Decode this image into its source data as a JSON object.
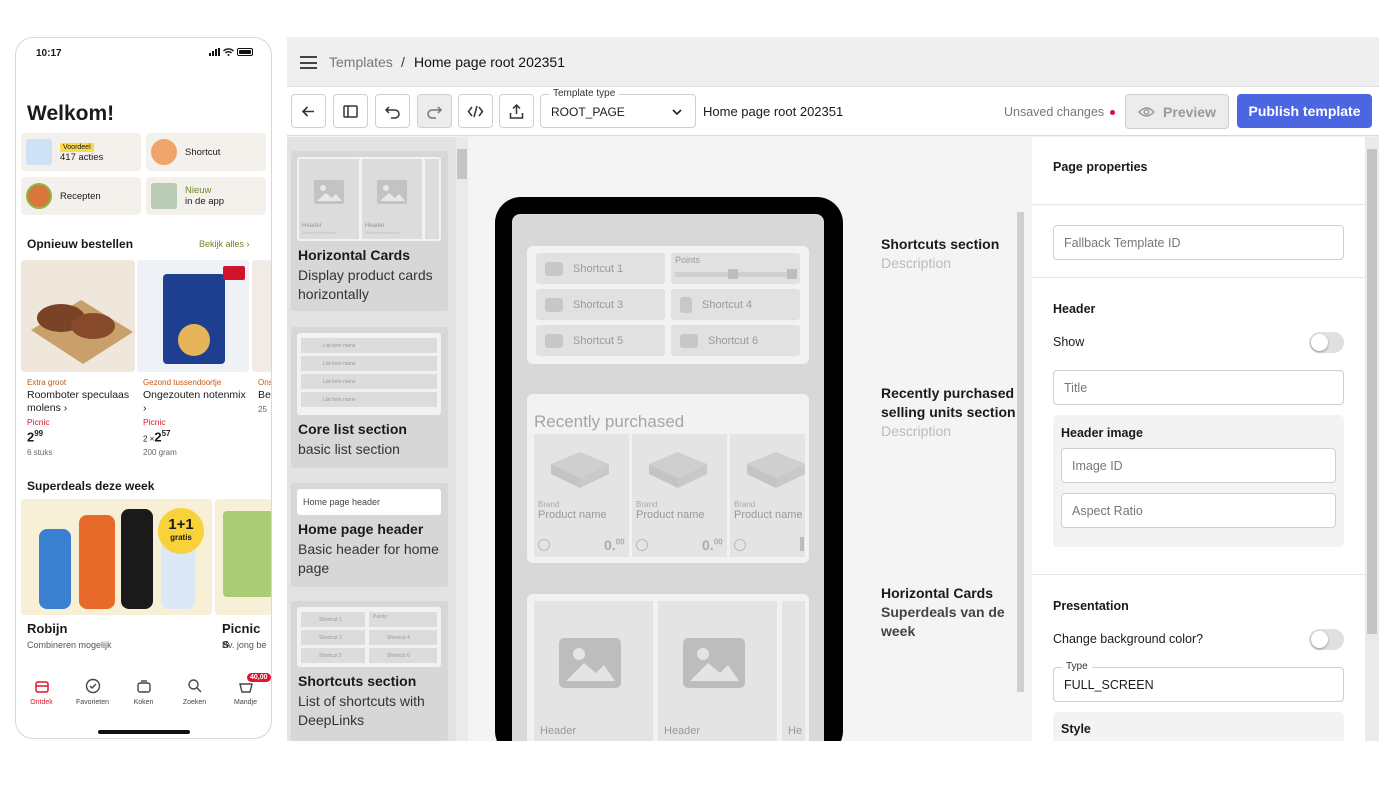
{
  "phone": {
    "time": "10:17",
    "welcome": "Welkom!",
    "tiles": [
      {
        "badge": "Voordeel",
        "label": "417 acties"
      },
      {
        "label": "Shortcut"
      },
      {
        "label": "Recepten"
      },
      {
        "label_green": "Nieuw",
        "label": "in de app"
      }
    ],
    "reorder": {
      "title": "Opnieuw bestellen",
      "link": "Bekijk alles",
      "products": [
        {
          "category": "Extra groot",
          "name": "Roomboter speculaas molens",
          "brand": "Picnic",
          "price_main": "2",
          "price_cents": "99",
          "unit": "6 stuks"
        },
        {
          "category": "Gezond tussendoortje",
          "name": "Ongezouten notenmix",
          "brand": "Picnic",
          "qty": "2 ×",
          "price_main": "2",
          "price_cents": "57",
          "unit": "200 gram"
        },
        {
          "category": "Ons",
          "name": "Be",
          "unit": "25"
        }
      ]
    },
    "deals": {
      "title": "Superdeals deze week",
      "badge_top": "1+1",
      "badge_bottom": "gratis",
      "items": [
        {
          "name": "Robijn",
          "sub": "Combineren mogelijk"
        },
        {
          "name": "Picnic s",
          "sub": "Bv. jong be"
        }
      ]
    },
    "tabs": [
      "Ontdek",
      "Favorieten",
      "Koken",
      "Zoeken",
      "Mandje"
    ],
    "cart_badge": "40,00"
  },
  "editor": {
    "breadcrumb": {
      "root": "Templates",
      "sep": "/",
      "current": "Home page root 202351"
    },
    "template_type_label": "Template type",
    "template_type_value": "ROOT_PAGE",
    "template_name": "Home page root 202351",
    "unsaved": "Unsaved changes",
    "preview": "Preview",
    "publish": "Publish template",
    "palette": [
      {
        "title": "Horizontal Cards",
        "desc": "Display product cards horizontally",
        "thumb_header": "Header",
        "thumb_sub": "Subtext description"
      },
      {
        "title": "Core list section",
        "desc": "basic list section",
        "thumb_item": "List item name"
      },
      {
        "title": "Home page header",
        "desc": "Basic header for home page",
        "thumb_text": "Home page header"
      },
      {
        "title": "Shortcuts section",
        "desc": "List of shortcuts with DeepLinks",
        "thumb_items": [
          "Shortcut 1",
          "Points",
          "Shortcut 3",
          "Shortcut 4",
          "Shortcut 5",
          "Shortcut 6"
        ]
      }
    ],
    "canvas": {
      "shortcuts": [
        "Shortcut 1",
        "Shortcut 3",
        "Shortcut 4",
        "Shortcut 5",
        "Shortcut 6"
      ],
      "points_label": "Points",
      "recent_title": "Recently purchased",
      "product_brand": "Brand",
      "product_name": "Product name",
      "product_price": "0.",
      "product_price_sup": "00",
      "hcard_header": "Header",
      "hcard_header_cut": "He",
      "labels": [
        {
          "title": "Shortcuts section",
          "desc": "Description"
        },
        {
          "title": "Recently purchased selling units section",
          "desc": "Description"
        },
        {
          "title": "Horizontal Cards",
          "sub": "Superdeals van de week"
        }
      ]
    },
    "props": {
      "page_properties": "Page properties",
      "fallback_placeholder": "Fallback Template ID",
      "header": "Header",
      "show": "Show",
      "title_placeholder": "Title",
      "header_image": "Header image",
      "image_id_placeholder": "Image ID",
      "aspect_ratio_placeholder": "Aspect Ratio",
      "presentation": "Presentation",
      "change_bg": "Change background color?",
      "type_label": "Type",
      "type_value": "FULL_SCREEN",
      "style": "Style"
    }
  },
  "colors": {
    "publish": "#4b66e0",
    "unsaved_dot": "#d0143e",
    "picnic_red": "#e0142c",
    "link_green": "#6b8a2a"
  }
}
